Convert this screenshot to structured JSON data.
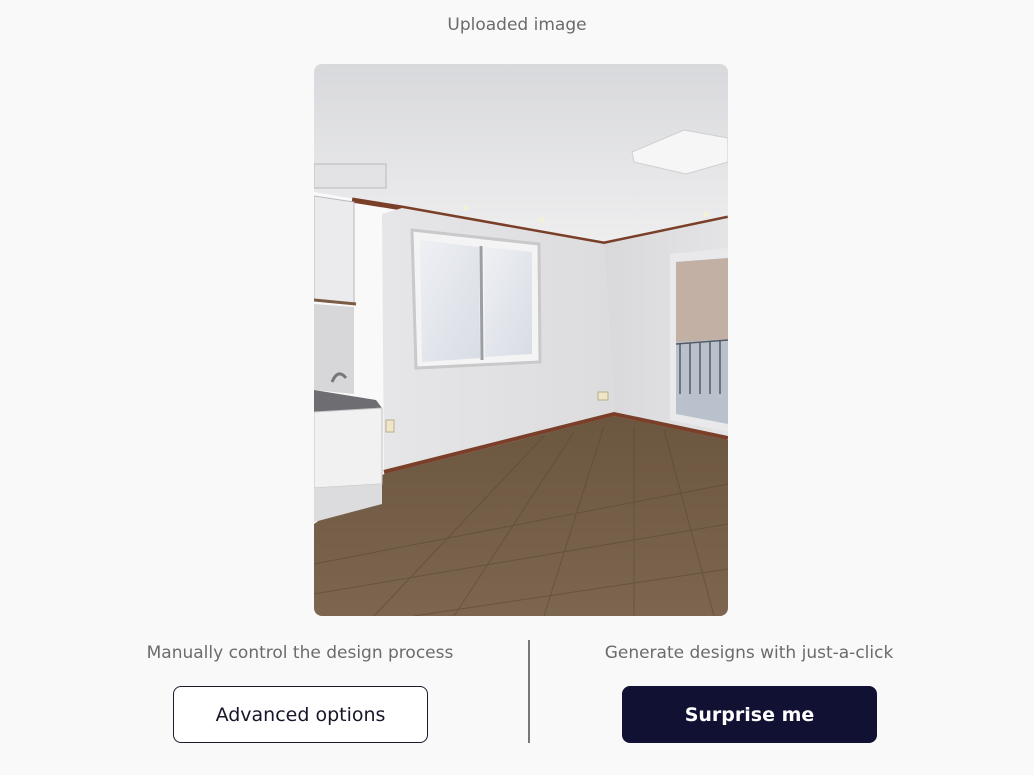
{
  "header": {
    "title": "Uploaded image"
  },
  "image": {
    "description_icon": "room-photo"
  },
  "manual": {
    "caption": "Manually control the design process",
    "button_label": "Advanced options"
  },
  "auto": {
    "caption": "Generate designs with just-a-click",
    "button_label": "Surprise me"
  },
  "colors": {
    "primary": "#111133",
    "background": "#f9f9f9",
    "muted_text": "#6b6b6b"
  }
}
